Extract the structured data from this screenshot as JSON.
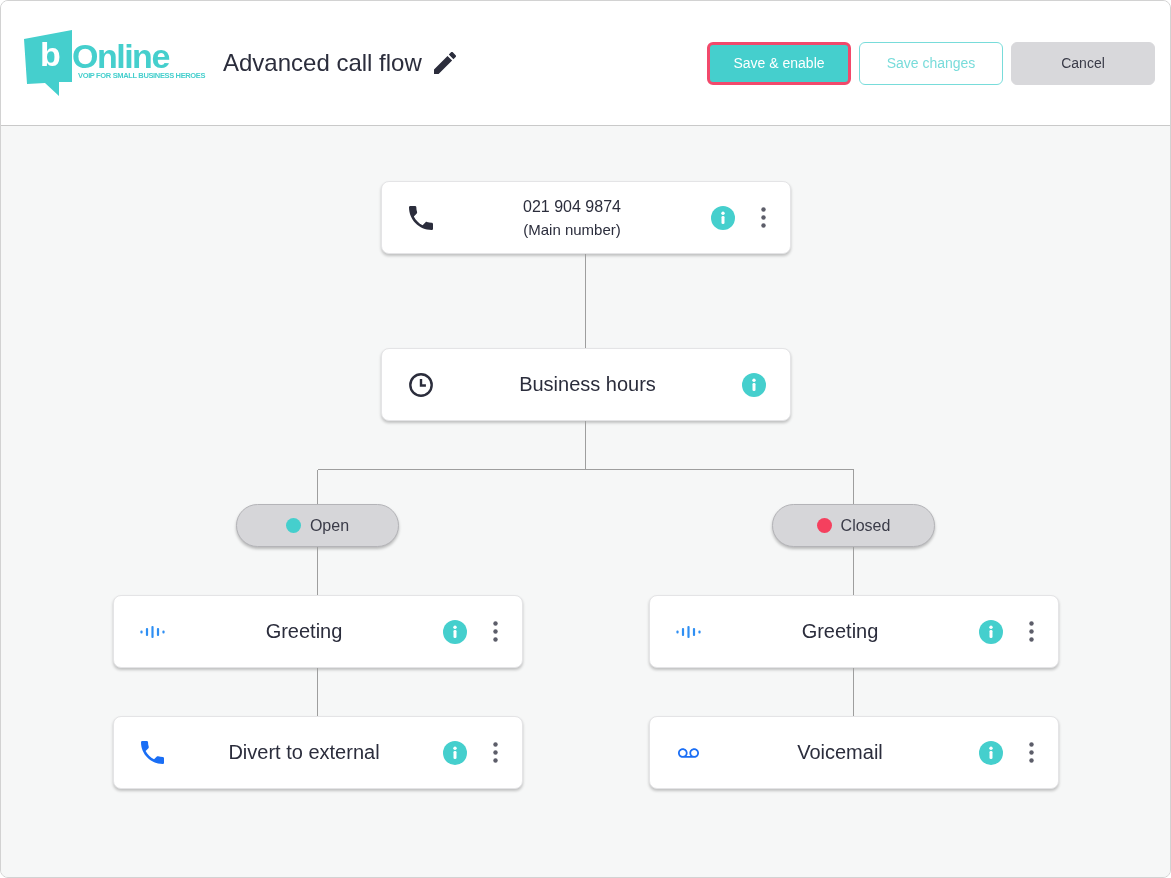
{
  "header": {
    "logo": {
      "mark": "b",
      "wordmark": "Online",
      "tagline": "VOIP FOR SMALL BUSINESS HEROES"
    },
    "title": "Advanced call flow",
    "buttons": [
      {
        "label": "Save & enable",
        "kind": "primary",
        "focused": true,
        "disabled": false
      },
      {
        "label": "Save changes",
        "kind": "outline",
        "focused": false,
        "disabled": true
      },
      {
        "label": "Cancel",
        "kind": "neutral",
        "focused": false,
        "disabled": false
      }
    ]
  },
  "flow": {
    "kind": "number",
    "number": "021 904 9874",
    "note": "(Main number)",
    "menu": true,
    "children": [
      {
        "kind": "hours",
        "label": "Business hours",
        "menu": false,
        "children": [
          {
            "kind": "branch",
            "label": "Open",
            "color": "#45cfcd",
            "children": [
              {
                "kind": "greeting",
                "label": "Greeting",
                "menu": true,
                "children": [
                  {
                    "kind": "divert",
                    "label": "Divert to external",
                    "menu": true
                  }
                ]
              }
            ]
          },
          {
            "kind": "branch",
            "label": "Closed",
            "color": "#f5405e",
            "children": [
              {
                "kind": "greeting",
                "label": "Greeting",
                "menu": true,
                "children": [
                  {
                    "kind": "voicemail",
                    "label": "Voicemail",
                    "menu": true
                  }
                ]
              }
            ]
          }
        ]
      }
    ]
  }
}
